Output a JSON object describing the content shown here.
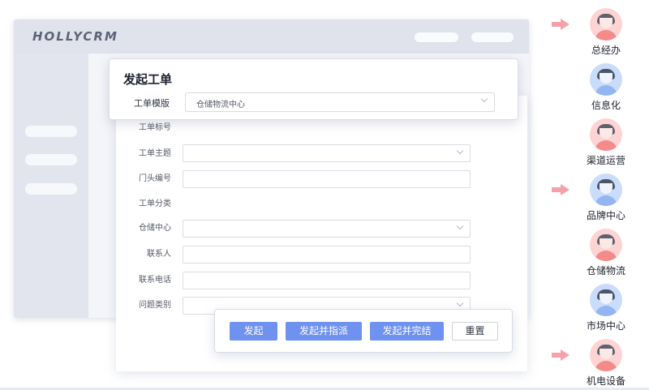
{
  "app": {
    "logo": "HOLLYCRM"
  },
  "panel": {
    "title": "发起工单",
    "template_label": "工单模版",
    "template_value": "仓储物流中心"
  },
  "form": {
    "fields": [
      {
        "label": "工单标号",
        "type": "text-static"
      },
      {
        "label": "工单主题",
        "type": "select"
      },
      {
        "label": "门头编号",
        "type": "input"
      },
      {
        "label": "工单分类",
        "type": "text-static"
      },
      {
        "label": "仓储中心",
        "type": "select"
      },
      {
        "label": "联系人",
        "type": "input"
      },
      {
        "label": "联系电话",
        "type": "input"
      },
      {
        "label": "问题类别",
        "type": "select"
      }
    ]
  },
  "actions": {
    "launch": "发起",
    "launch_assign": "发起并指派",
    "launch_complete": "发起并完结",
    "reset": "重置"
  },
  "orgs": [
    {
      "name": "总经办",
      "color": "pink",
      "arrow": true
    },
    {
      "name": "信息化",
      "color": "blue",
      "arrow": false
    },
    {
      "name": "渠道运营",
      "color": "pink",
      "arrow": false
    },
    {
      "name": "品牌中心",
      "color": "blue",
      "arrow": true
    },
    {
      "name": "仓储物流",
      "color": "pink",
      "arrow": false
    },
    {
      "name": "市场中心",
      "color": "blue",
      "arrow": false
    },
    {
      "name": "机电设备",
      "color": "pink",
      "arrow": true
    }
  ],
  "colors": {
    "primary_button": "#6f91ef",
    "arrow": "#f4a1a9",
    "avatar_pink": "#fdd3d3",
    "avatar_blue": "#c9dcfb"
  }
}
